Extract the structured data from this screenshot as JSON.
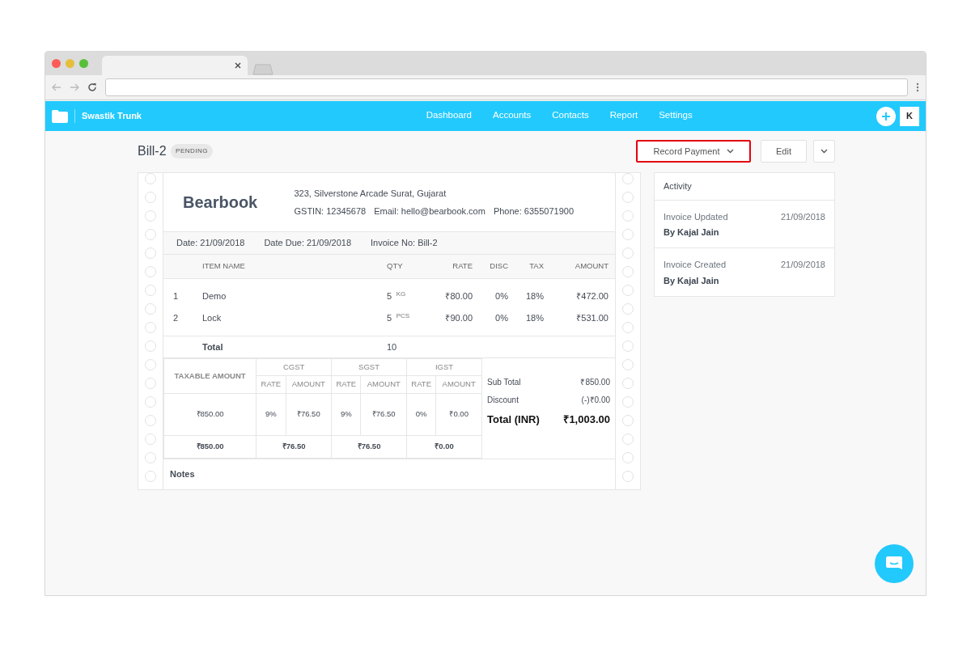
{
  "app": {
    "brand": "Swastik Trunk",
    "nav": [
      {
        "label": "Dashboard",
        "selected": false
      },
      {
        "label": "Accounts",
        "selected": false
      },
      {
        "label": "Contacts",
        "selected": false
      },
      {
        "label": "Report",
        "selected": false
      },
      {
        "label": "Settings",
        "selected": false
      }
    ],
    "avatar": "K"
  },
  "bill": {
    "title": "Bill-2",
    "status": "PENDING",
    "actions": [
      {
        "kind": "dropdown",
        "label": "Record Payment",
        "highlighted": true
      },
      {
        "kind": "plain",
        "label": "Edit",
        "highlighted": false
      },
      {
        "kind": "caret",
        "highlighted": false
      }
    ]
  },
  "invoice": {
    "company": "Bearbook",
    "address": "323, Silverstone Arcade Surat, Gujarat",
    "contacts": [
      "GSTIN: 12345678",
      "Email: hello@bearbook.com",
      "Phone: 6355071900"
    ],
    "meta": [
      {
        "label": "Date:",
        "value": "21/09/2018"
      },
      {
        "label": "Date Due:",
        "value": "21/09/2018"
      },
      {
        "label": "Invoice No:",
        "value": "Bill-2"
      }
    ],
    "columns": [
      "ITEM NAME",
      "QTY",
      "RATE",
      "DISC",
      "TAX",
      "AMOUNT"
    ],
    "items": [
      {
        "no": "1",
        "name": "Demo",
        "qty": "5",
        "unit": "KG",
        "rate": "₹80.00",
        "disc": "0%",
        "tax": "18%",
        "amount": "₹472.00"
      },
      {
        "no": "2",
        "name": "Lock",
        "qty": "5",
        "unit": "PCS",
        "rate": "₹90.00",
        "disc": "0%",
        "tax": "18%",
        "amount": "₹531.00"
      }
    ],
    "total": {
      "label": "Total",
      "qty": "10"
    },
    "tax_table": {
      "taxable_heading": "TAXABLE AMOUNT",
      "taxable": "₹850.00",
      "taxable_total": "₹850.00",
      "groups": [
        {
          "name": "CGST",
          "rate_heading": "RATE",
          "amount_heading": "AMOUNT",
          "rate": "9%",
          "amount": "₹76.50",
          "total": "₹76.50"
        },
        {
          "name": "SGST",
          "rate_heading": "RATE",
          "amount_heading": "AMOUNT",
          "rate": "9%",
          "amount": "₹76.50",
          "total": "₹76.50"
        },
        {
          "name": "IGST",
          "rate_heading": "RATE",
          "amount_heading": "AMOUNT",
          "rate": "0%",
          "amount": "₹0.00",
          "total": "₹0.00"
        }
      ]
    },
    "summary": [
      {
        "kind": "line",
        "label": "Sub Total",
        "value": "₹850.00"
      },
      {
        "kind": "line",
        "label": "Discount",
        "value": "(-)₹0.00"
      },
      {
        "kind": "grand",
        "label": "Total (INR)",
        "value": "₹1,003.00"
      }
    ],
    "notes_label": "Notes"
  },
  "activity": {
    "title": "Activity",
    "entries": [
      {
        "event": "Invoice Updated",
        "by": "By Kajal Jain",
        "date": "21/09/2018"
      },
      {
        "event": "Invoice Created",
        "by": "By Kajal Jain",
        "date": "21/09/2018"
      }
    ]
  }
}
